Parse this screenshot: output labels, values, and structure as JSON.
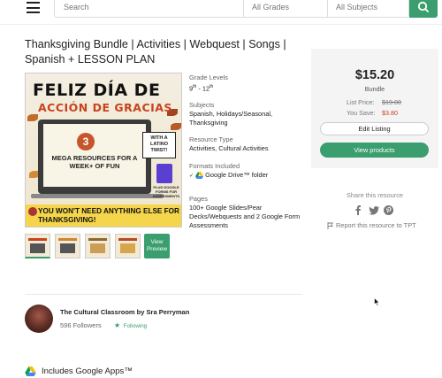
{
  "search": {
    "placeholder": "Search",
    "grades": "All Grades",
    "subjects": "All Subjects"
  },
  "product": {
    "title": "Thanksgiving Bundle | Activities | Webquest | Songs | Spanish + LESSON PLAN",
    "image": {
      "line1": "FELIZ DÍA DE",
      "line2": "ACCIÓN DE GRACIAS",
      "number": "3",
      "mega": "MEGA RESOURCES FOR A WEEK+ OF FUN",
      "badge": "WITH A LATINO TWIST!",
      "doc_caption": "PLUS GOOGLE FORMS FOR ASSESSMENTS",
      "banner": "YOU WON'T NEED ANYTHING ELSE FOR THANKSGIVING!"
    },
    "view_preview": "View Preview"
  },
  "details": {
    "grade_label": "Grade Levels",
    "grade_from": "9",
    "grade_from_sup": "th",
    "grade_sep": " - ",
    "grade_to": "12",
    "grade_to_sup": "th",
    "subjects_label": "Subjects",
    "subjects_value": "Spanish, Holidays/Seasonal, Thanksgiving",
    "type_label": "Resource Type",
    "type_value": "Activities, Cultural Activities",
    "formats_label": "Formats Included",
    "formats_value": "Google Drive™ folder",
    "pages_label": "Pages",
    "pages_value": "100+ Google Slides/Pear Decks/Webquests and 2 Google Form Assessments"
  },
  "purchase": {
    "price": "$15.20",
    "type": "Bundle",
    "list_price_label": "List Price:",
    "list_price": "$19.00",
    "you_save_label": "You Save:",
    "you_save": "$3.80",
    "edit_label": "Edit Listing",
    "view_label": "View products"
  },
  "share": {
    "label": "Share this resource",
    "report": "Report this resource to TPT"
  },
  "author": {
    "name": "The Cultural Classroom by Sra Perryman",
    "followers": "596 Followers",
    "following": "Following"
  },
  "apps": {
    "label": "Includes Google Apps™"
  },
  "colors": {
    "accent": "#3a9e6e",
    "save": "#c8431d"
  },
  "icons": [
    "menu-icon",
    "search-icon",
    "google-drive-icon",
    "facebook-icon",
    "twitter-icon",
    "pinterest-icon",
    "flag-icon",
    "star-icon",
    "cursor-icon"
  ]
}
